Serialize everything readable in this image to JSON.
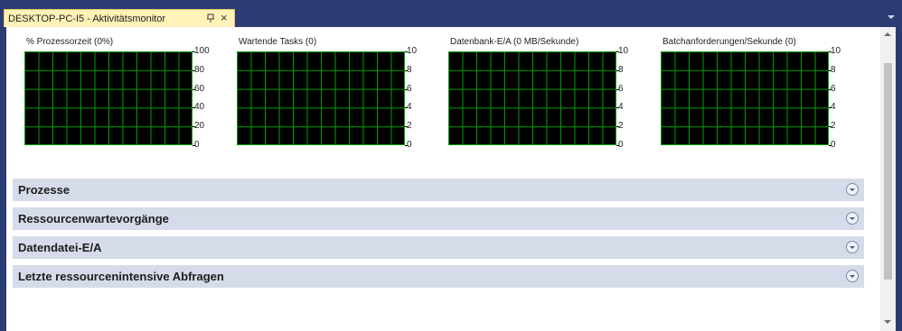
{
  "tab": {
    "title": "DESKTOP-PC-I5 - Aktivitätsmonitor",
    "pin_icon": "pin-icon",
    "close_glyph": "×"
  },
  "charts": [
    {
      "title": "% Prozessorzeit (0%)",
      "ticks": [
        "100",
        "80",
        "60",
        "40",
        "20",
        "0"
      ]
    },
    {
      "title": "Wartende Tasks (0)",
      "ticks": [
        "10",
        "8",
        "6",
        "4",
        "2",
        "0"
      ]
    },
    {
      "title": "Datenbank-E/A (0 MB/Sekunde)",
      "ticks": [
        "10",
        "8",
        "6",
        "4",
        "2",
        "0"
      ]
    },
    {
      "title": "Batchanforderungen/Sekunde (0)",
      "ticks": [
        "10",
        "8",
        "6",
        "4",
        "2",
        "0"
      ]
    }
  ],
  "sections": [
    {
      "label": "Prozesse"
    },
    {
      "label": "Ressourcenwartevorgänge"
    },
    {
      "label": "Datendatei-E/A"
    },
    {
      "label": "Letzte ressourcenintensive Abfragen"
    }
  ],
  "colors": {
    "frame": "#2b3c74",
    "tab": "#fff3b8",
    "grid": "#00a000",
    "section": "#d5dbe9"
  }
}
